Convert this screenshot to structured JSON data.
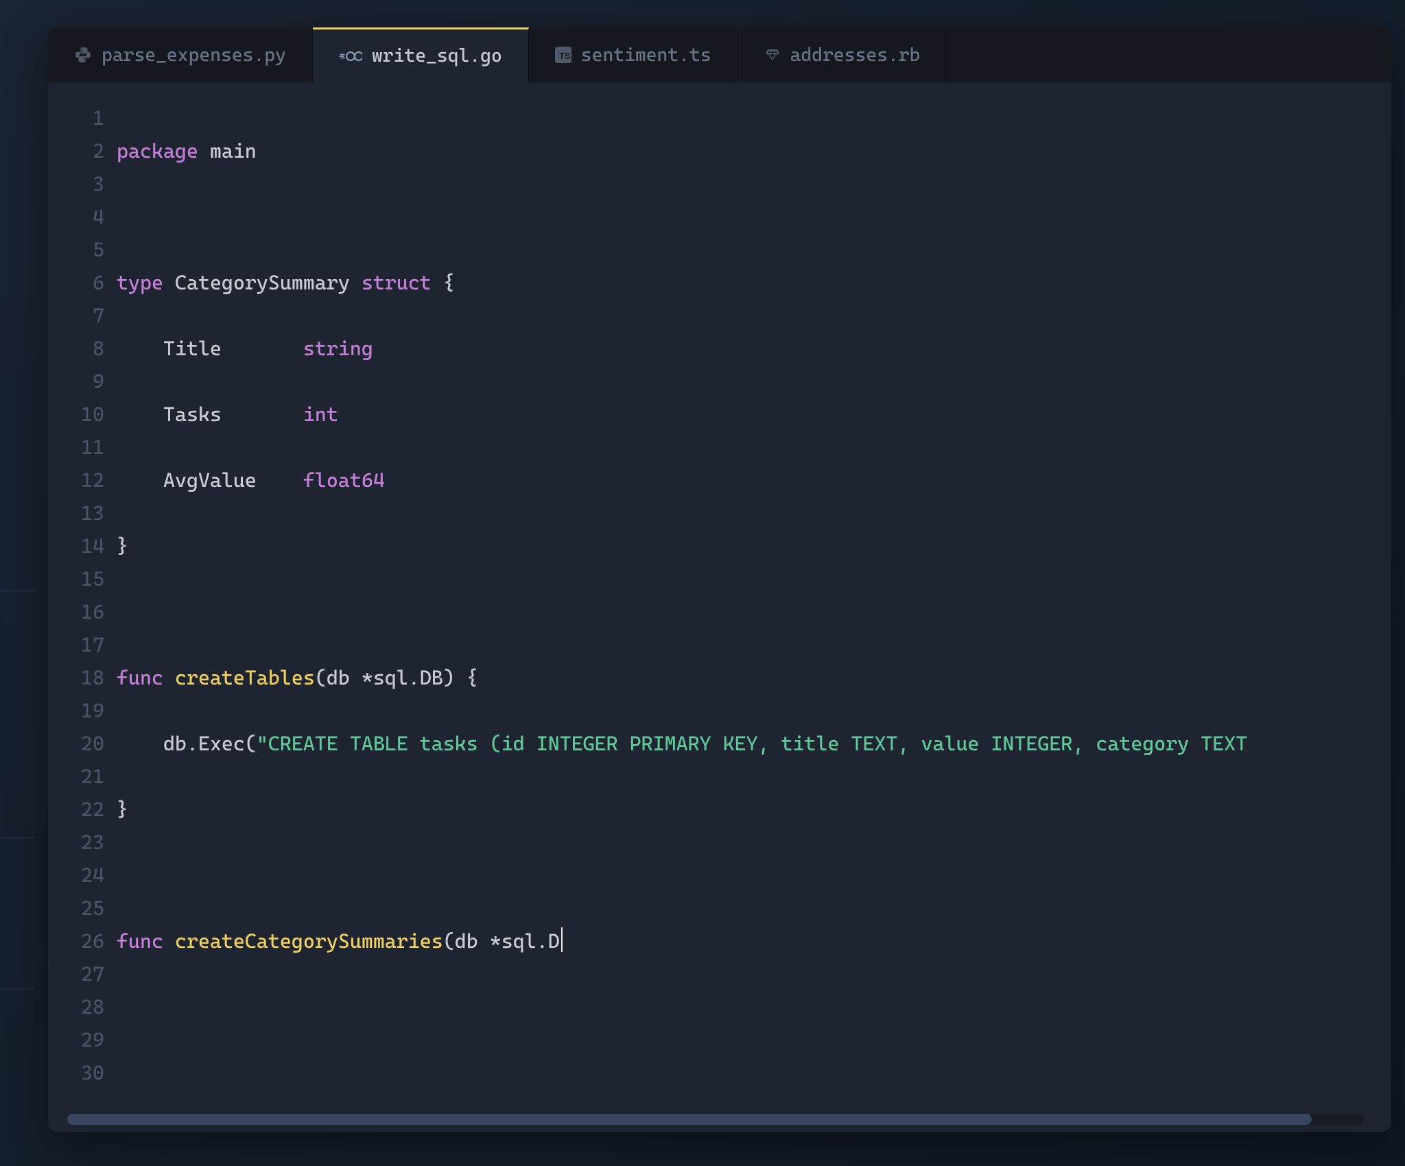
{
  "tabs": [
    {
      "label": "parse_expenses.py",
      "icon": "python-icon",
      "active": false
    },
    {
      "label": "write_sql.go",
      "icon": "go-icon",
      "active": true
    },
    {
      "label": "sentiment.ts",
      "icon": "typescript-icon",
      "active": false
    },
    {
      "label": "addresses.rb",
      "icon": "ruby-icon",
      "active": false
    }
  ],
  "line_numbers": [
    "1",
    "2",
    "3",
    "4",
    "5",
    "6",
    "7",
    "8",
    "9",
    "10",
    "11",
    "12",
    "13",
    "14",
    "15",
    "16",
    "17",
    "18",
    "19",
    "20",
    "21",
    "22",
    "23",
    "24",
    "25",
    "26",
    "27",
    "28",
    "29",
    "30"
  ],
  "code": {
    "l1_kw1": "package",
    "l1_id": " main",
    "l3_kw1": "type",
    "l3_id": " CategorySummary ",
    "l3_kw2": "struct",
    "l3_pc": " {",
    "l4_id": "    Title       ",
    "l4_typ": "string",
    "l5_id": "    Tasks       ",
    "l5_typ": "int",
    "l6_id": "    AvgValue    ",
    "l6_typ": "float64",
    "l7": "}",
    "l9_kw": "func",
    "l9_fn": " createTables",
    "l9_rest": "(db *sql.DB) {",
    "l10_pre": "    db.Exec(",
    "l10_str": "\"CREATE TABLE tasks (id INTEGER PRIMARY KEY, title TEXT, value INTEGER, category TEXT",
    "l11": "}",
    "l13_kw": "func",
    "l13_fn": " createCategorySummaries",
    "l13_rest": "(db *sql.D"
  }
}
